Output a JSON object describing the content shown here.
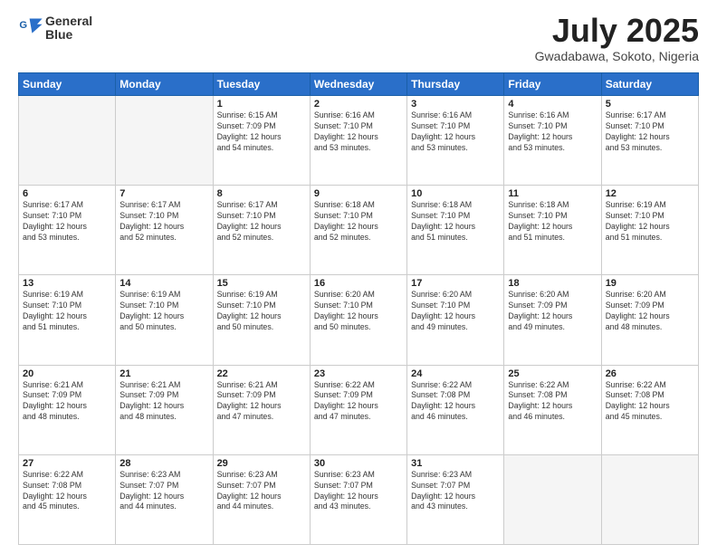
{
  "header": {
    "logo_line1": "General",
    "logo_line2": "Blue",
    "month_year": "July 2025",
    "location": "Gwadabawa, Sokoto, Nigeria"
  },
  "days_of_week": [
    "Sunday",
    "Monday",
    "Tuesday",
    "Wednesday",
    "Thursday",
    "Friday",
    "Saturday"
  ],
  "weeks": [
    [
      {
        "day": "",
        "info": ""
      },
      {
        "day": "",
        "info": ""
      },
      {
        "day": "1",
        "info": "Sunrise: 6:15 AM\nSunset: 7:09 PM\nDaylight: 12 hours\nand 54 minutes."
      },
      {
        "day": "2",
        "info": "Sunrise: 6:16 AM\nSunset: 7:10 PM\nDaylight: 12 hours\nand 53 minutes."
      },
      {
        "day": "3",
        "info": "Sunrise: 6:16 AM\nSunset: 7:10 PM\nDaylight: 12 hours\nand 53 minutes."
      },
      {
        "day": "4",
        "info": "Sunrise: 6:16 AM\nSunset: 7:10 PM\nDaylight: 12 hours\nand 53 minutes."
      },
      {
        "day": "5",
        "info": "Sunrise: 6:17 AM\nSunset: 7:10 PM\nDaylight: 12 hours\nand 53 minutes."
      }
    ],
    [
      {
        "day": "6",
        "info": "Sunrise: 6:17 AM\nSunset: 7:10 PM\nDaylight: 12 hours\nand 53 minutes."
      },
      {
        "day": "7",
        "info": "Sunrise: 6:17 AM\nSunset: 7:10 PM\nDaylight: 12 hours\nand 52 minutes."
      },
      {
        "day": "8",
        "info": "Sunrise: 6:17 AM\nSunset: 7:10 PM\nDaylight: 12 hours\nand 52 minutes."
      },
      {
        "day": "9",
        "info": "Sunrise: 6:18 AM\nSunset: 7:10 PM\nDaylight: 12 hours\nand 52 minutes."
      },
      {
        "day": "10",
        "info": "Sunrise: 6:18 AM\nSunset: 7:10 PM\nDaylight: 12 hours\nand 51 minutes."
      },
      {
        "day": "11",
        "info": "Sunrise: 6:18 AM\nSunset: 7:10 PM\nDaylight: 12 hours\nand 51 minutes."
      },
      {
        "day": "12",
        "info": "Sunrise: 6:19 AM\nSunset: 7:10 PM\nDaylight: 12 hours\nand 51 minutes."
      }
    ],
    [
      {
        "day": "13",
        "info": "Sunrise: 6:19 AM\nSunset: 7:10 PM\nDaylight: 12 hours\nand 51 minutes."
      },
      {
        "day": "14",
        "info": "Sunrise: 6:19 AM\nSunset: 7:10 PM\nDaylight: 12 hours\nand 50 minutes."
      },
      {
        "day": "15",
        "info": "Sunrise: 6:19 AM\nSunset: 7:10 PM\nDaylight: 12 hours\nand 50 minutes."
      },
      {
        "day": "16",
        "info": "Sunrise: 6:20 AM\nSunset: 7:10 PM\nDaylight: 12 hours\nand 50 minutes."
      },
      {
        "day": "17",
        "info": "Sunrise: 6:20 AM\nSunset: 7:10 PM\nDaylight: 12 hours\nand 49 minutes."
      },
      {
        "day": "18",
        "info": "Sunrise: 6:20 AM\nSunset: 7:09 PM\nDaylight: 12 hours\nand 49 minutes."
      },
      {
        "day": "19",
        "info": "Sunrise: 6:20 AM\nSunset: 7:09 PM\nDaylight: 12 hours\nand 48 minutes."
      }
    ],
    [
      {
        "day": "20",
        "info": "Sunrise: 6:21 AM\nSunset: 7:09 PM\nDaylight: 12 hours\nand 48 minutes."
      },
      {
        "day": "21",
        "info": "Sunrise: 6:21 AM\nSunset: 7:09 PM\nDaylight: 12 hours\nand 48 minutes."
      },
      {
        "day": "22",
        "info": "Sunrise: 6:21 AM\nSunset: 7:09 PM\nDaylight: 12 hours\nand 47 minutes."
      },
      {
        "day": "23",
        "info": "Sunrise: 6:22 AM\nSunset: 7:09 PM\nDaylight: 12 hours\nand 47 minutes."
      },
      {
        "day": "24",
        "info": "Sunrise: 6:22 AM\nSunset: 7:08 PM\nDaylight: 12 hours\nand 46 minutes."
      },
      {
        "day": "25",
        "info": "Sunrise: 6:22 AM\nSunset: 7:08 PM\nDaylight: 12 hours\nand 46 minutes."
      },
      {
        "day": "26",
        "info": "Sunrise: 6:22 AM\nSunset: 7:08 PM\nDaylight: 12 hours\nand 45 minutes."
      }
    ],
    [
      {
        "day": "27",
        "info": "Sunrise: 6:22 AM\nSunset: 7:08 PM\nDaylight: 12 hours\nand 45 minutes."
      },
      {
        "day": "28",
        "info": "Sunrise: 6:23 AM\nSunset: 7:07 PM\nDaylight: 12 hours\nand 44 minutes."
      },
      {
        "day": "29",
        "info": "Sunrise: 6:23 AM\nSunset: 7:07 PM\nDaylight: 12 hours\nand 44 minutes."
      },
      {
        "day": "30",
        "info": "Sunrise: 6:23 AM\nSunset: 7:07 PM\nDaylight: 12 hours\nand 43 minutes."
      },
      {
        "day": "31",
        "info": "Sunrise: 6:23 AM\nSunset: 7:07 PM\nDaylight: 12 hours\nand 43 minutes."
      },
      {
        "day": "",
        "info": ""
      },
      {
        "day": "",
        "info": ""
      }
    ]
  ]
}
